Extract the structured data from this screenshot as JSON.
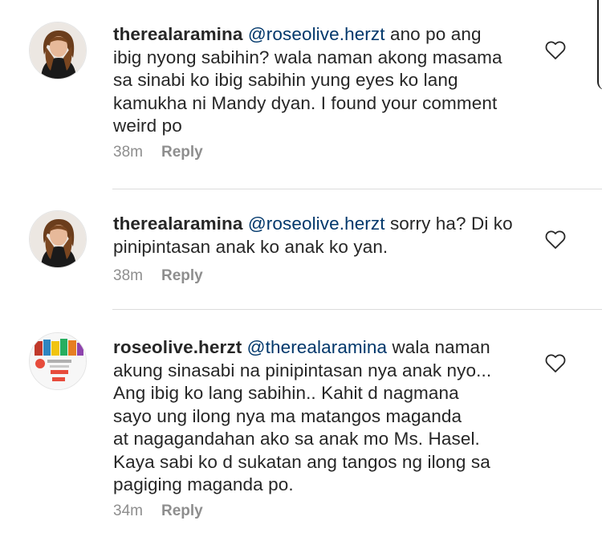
{
  "comments": [
    {
      "username": "therealaramina",
      "mention": "@roseolive.herzt",
      "lines_first": " ano po ang",
      "lines": [
        "ibig nyong sabihin? wala naman akong masama",
        "sa sinabi ko ibig sabihin yung eyes ko lang",
        "kamukha ni Mandy dyan. I found your comment",
        "weird po"
      ],
      "time": "38m",
      "reply_label": "Reply",
      "avatar_icon": "profile-photo-woman"
    },
    {
      "username": "therealaramina",
      "mention": "@roseolive.herzt",
      "lines_first": " sorry ha? Di ko",
      "lines": [
        "pinipintasan anak ko anak ko yan."
      ],
      "time": "38m",
      "reply_label": "Reply",
      "avatar_icon": "profile-photo-woman"
    },
    {
      "username": "roseolive.herzt",
      "mention": "@therealaramina",
      "lines_first": " wala naman",
      "lines": [
        "akung sinasabi na pinipintasan nya anak nyo...",
        "Ang ibig ko lang sabihin.. Kahit d nagmana",
        "sayo ung ilong nya ma matangos maganda",
        "at nagagandahan ako sa anak mo Ms. Hasel.",
        "Kaya sabi ko d sukatan ang tangos ng ilong sa",
        "pagiging maganda po."
      ],
      "time": "34m",
      "reply_label": "Reply",
      "avatar_icon": "profile-photo-grocery-package"
    }
  ],
  "colors": {
    "username": "#262626",
    "mention": "#00376b",
    "meta": "#8e8e8e",
    "divider": "#dcdcdc"
  },
  "icons": {
    "like": "heart-outline-icon"
  }
}
